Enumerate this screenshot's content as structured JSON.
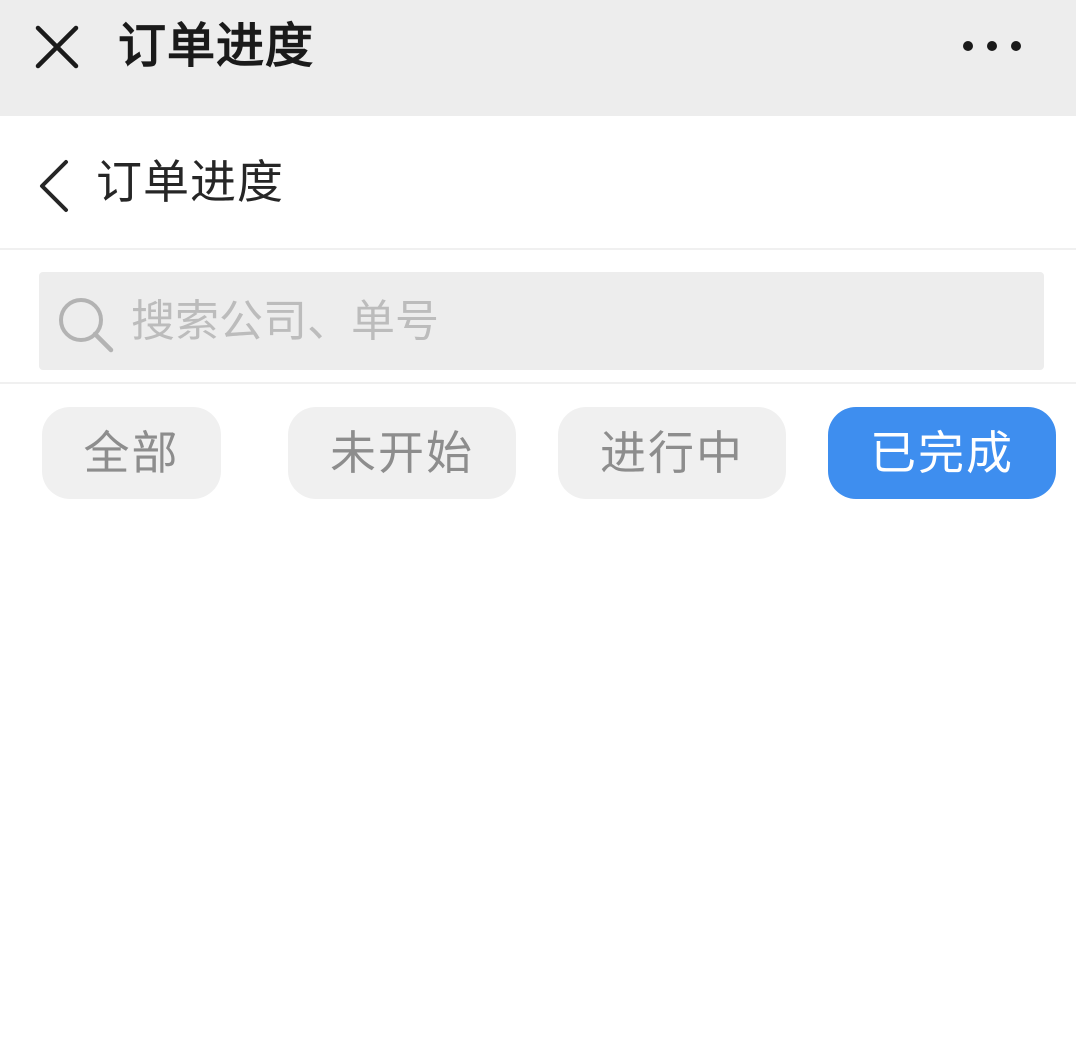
{
  "topbar": {
    "title": "订单进度",
    "close_icon": "close-icon",
    "more_icon": "more-dots-icon"
  },
  "navbar": {
    "title": "订单进度",
    "back_icon": "chevron-left-icon"
  },
  "search": {
    "placeholder": "搜索公司、单号",
    "value": "",
    "icon": "search-icon"
  },
  "filters": [
    {
      "label": "全部",
      "active": false
    },
    {
      "label": "未开始",
      "active": false
    },
    {
      "label": "进行中",
      "active": false
    },
    {
      "label": "已完成",
      "active": true
    }
  ],
  "colors": {
    "accent": "#3e8eef",
    "topbar_bg": "#ededed",
    "chip_bg": "#f0f0f0",
    "chip_text": "#8d8d8d"
  }
}
